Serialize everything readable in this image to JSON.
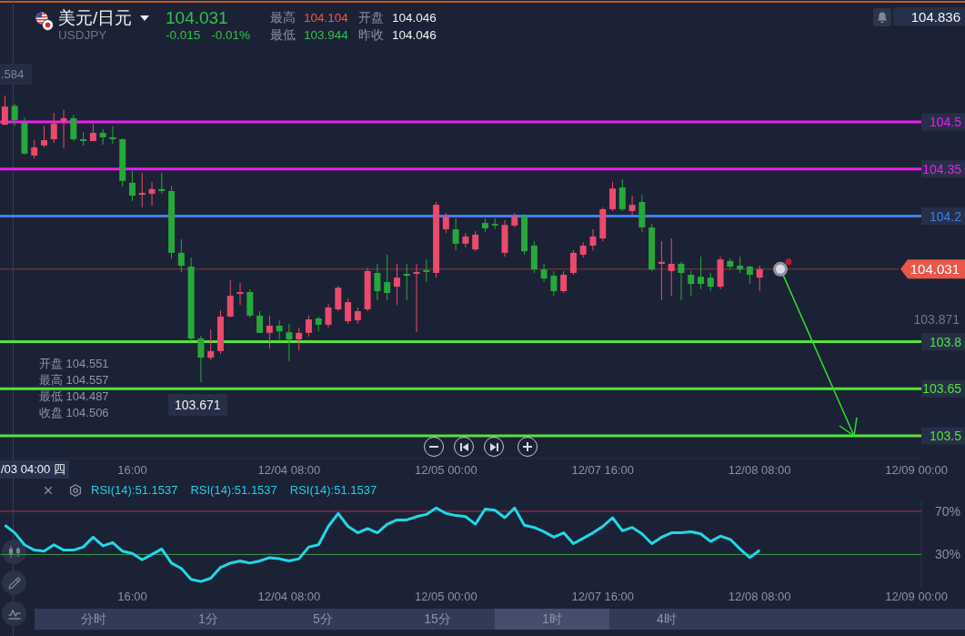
{
  "header": {
    "pair": "美元/日元",
    "symbol": "USDJPY",
    "price": "104.031",
    "change": "-0.015",
    "change_percent": "-0.01%",
    "stats": [
      {
        "label": "最高",
        "value": "104.104",
        "kind": "rise"
      },
      {
        "label": "开盘",
        "value": "104.046",
        "kind": "plain"
      },
      {
        "label": "最低",
        "value": "103.944",
        "kind": "fall"
      },
      {
        "label": "昨收",
        "value": "104.046",
        "kind": "plain"
      }
    ]
  },
  "chart": {
    "crosshair_price": ".584",
    "crosshair_time": "/03 04:00 四",
    "ohlc_readout": [
      "开盘 104.551",
      "最高 104.557",
      "最低 104.487",
      "收盘 104.506"
    ],
    "low_marker": "103.671",
    "chart_data": {
      "type": "candlestick",
      "categories": [
        null,
        null,
        null,
        null,
        null,
        null,
        null,
        null,
        null,
        null,
        null,
        null,
        null,
        "16:00",
        null,
        null,
        null,
        null,
        null,
        null,
        null,
        null,
        null,
        null,
        null,
        null,
        null,
        null,
        null,
        "12/04 08:00",
        null,
        null,
        null,
        null,
        null,
        null,
        null,
        null,
        null,
        null,
        null,
        null,
        null,
        null,
        null,
        "12/05 00:00",
        null,
        null,
        null,
        null,
        null,
        null,
        null,
        null,
        null,
        null,
        null,
        null,
        null,
        null,
        null,
        "12/07 16:00",
        null,
        null,
        null,
        null,
        null,
        null,
        null,
        null,
        null,
        null,
        null,
        null,
        null,
        null,
        null,
        "12/08 08:00",
        null,
        null,
        null,
        null,
        null,
        null,
        null,
        null,
        null,
        null,
        null,
        null,
        null,
        null,
        null,
        "12/09 00:00"
      ],
      "ohlc": [
        [
          104.491,
          104.584,
          104.491,
          104.549
        ],
        [
          104.551,
          104.557,
          104.487,
          104.506
        ],
        [
          104.497,
          104.514,
          104.396,
          104.399
        ],
        [
          104.393,
          104.442,
          104.384,
          104.419
        ],
        [
          104.425,
          104.488,
          104.419,
          104.442
        ],
        [
          104.445,
          104.529,
          104.433,
          104.494
        ],
        [
          104.503,
          104.538,
          104.416,
          104.512
        ],
        [
          104.512,
          104.523,
          104.439,
          104.445
        ],
        [
          104.445,
          104.468,
          104.425,
          104.439
        ],
        [
          104.439,
          104.494,
          104.439,
          104.465
        ],
        [
          104.465,
          104.477,
          104.428,
          104.451
        ],
        [
          104.451,
          104.486,
          104.43,
          104.445
        ],
        [
          104.445,
          104.448,
          104.294,
          104.312
        ],
        [
          104.306,
          104.343,
          104.248,
          104.265
        ],
        [
          104.268,
          104.338,
          104.228,
          104.274
        ],
        [
          104.271,
          104.309,
          104.233,
          104.286
        ],
        [
          104.286,
          104.338,
          104.271,
          104.28
        ],
        [
          104.28,
          104.297,
          104.065,
          104.083
        ],
        [
          104.083,
          104.126,
          104.022,
          104.042
        ],
        [
          104.039,
          104.068,
          103.804,
          103.81
        ],
        [
          103.81,
          103.819,
          103.671,
          103.749
        ],
        [
          103.749,
          103.839,
          103.741,
          103.77
        ],
        [
          103.77,
          103.9,
          103.761,
          103.88
        ],
        [
          103.88,
          103.996,
          103.877,
          103.946
        ],
        [
          103.952,
          103.987,
          103.917,
          103.958
        ],
        [
          103.958,
          103.967,
          103.877,
          103.883
        ],
        [
          103.883,
          103.897,
          103.828,
          103.828
        ],
        [
          103.828,
          103.883,
          103.778,
          103.851
        ],
        [
          103.851,
          103.868,
          103.807,
          103.833
        ],
        [
          103.83,
          103.857,
          103.738,
          103.807
        ],
        [
          103.807,
          103.845,
          103.772,
          103.828
        ],
        [
          103.828,
          103.883,
          103.816,
          103.871
        ],
        [
          103.874,
          103.88,
          103.833,
          103.854
        ],
        [
          103.854,
          103.92,
          103.845,
          103.909
        ],
        [
          103.903,
          103.978,
          103.897,
          103.972
        ],
        [
          103.865,
          103.938,
          103.857,
          103.926
        ],
        [
          103.868,
          103.909,
          103.857,
          103.897
        ],
        [
          103.903,
          104.036,
          103.897,
          104.025
        ],
        [
          104.019,
          104.048,
          103.932,
          103.961
        ],
        [
          103.99,
          104.077,
          103.932,
          103.955
        ],
        [
          103.975,
          104.048,
          103.917,
          104.004
        ],
        [
          104.016,
          104.048,
          103.932,
          104.01
        ],
        [
          104.016,
          104.048,
          103.83,
          104.022
        ],
        [
          104.028,
          104.062,
          103.99,
          104.022
        ],
        [
          104.019,
          104.245,
          104.004,
          104.236
        ],
        [
          104.158,
          104.21,
          104.146,
          104.199
        ],
        [
          104.158,
          104.193,
          104.091,
          104.112
        ],
        [
          104.112,
          104.146,
          104.1,
          104.135
        ],
        [
          104.094,
          104.152,
          104.088,
          104.141
        ],
        [
          104.178,
          104.193,
          104.149,
          104.161
        ],
        [
          104.175,
          104.193,
          104.158,
          104.17
        ],
        [
          104.083,
          104.187,
          104.071,
          104.172
        ],
        [
          104.17,
          104.21,
          104.164,
          104.199
        ],
        [
          104.199,
          104.207,
          104.077,
          104.088
        ],
        [
          104.106,
          104.12,
          104.019,
          104.03
        ],
        [
          104.03,
          104.048,
          103.99,
          104.001
        ],
        [
          104.01,
          104.025,
          103.946,
          103.961
        ],
        [
          103.961,
          104.025,
          103.955,
          104.013
        ],
        [
          104.019,
          104.091,
          104.013,
          104.083
        ],
        [
          104.077,
          104.117,
          104.068,
          104.106
        ],
        [
          104.106,
          104.158,
          104.091,
          104.135
        ],
        [
          104.129,
          104.228,
          104.12,
          104.222
        ],
        [
          104.222,
          104.309,
          104.216,
          104.288
        ],
        [
          104.291,
          104.317,
          104.216,
          104.222
        ],
        [
          104.216,
          104.265,
          104.204,
          104.236
        ],
        [
          104.245,
          104.268,
          104.149,
          104.164
        ],
        [
          104.164,
          104.175,
          104.025,
          104.03
        ],
        [
          104.048,
          104.12,
          103.932,
          104.054
        ],
        [
          104.025,
          104.129,
          103.946,
          104.048
        ],
        [
          104.048,
          104.054,
          103.932,
          104.019
        ],
        [
          104.013,
          104.025,
          103.946,
          103.984
        ],
        [
          104.007,
          104.071,
          103.967,
          103.984
        ],
        [
          104.004,
          104.019,
          103.961,
          103.975
        ],
        [
          103.975,
          104.071,
          103.967,
          104.062
        ],
        [
          104.057,
          104.065,
          104.03,
          104.039
        ],
        [
          104.042,
          104.071,
          104.019,
          104.03
        ],
        [
          104.039,
          104.042,
          103.984,
          104.013
        ],
        [
          104.004,
          104.042,
          103.961,
          104.031
        ],
        null,
        null,
        null,
        null,
        null,
        null,
        null,
        null,
        null,
        null,
        null,
        null,
        null,
        null,
        null,
        null
      ],
      "ylim": [
        103.428,
        104.836
      ],
      "yticks": [
        {
          "value": 104.836,
          "label": "104.836"
        },
        {
          "value": 104.5,
          "label": "104.5"
        },
        {
          "value": 104.35,
          "label": "104.35"
        },
        {
          "value": 104.2,
          "label": "104.2"
        },
        {
          "value": 104.031,
          "label": "104.031"
        },
        {
          "value": 103.871,
          "label": "103.871"
        },
        {
          "value": 103.8,
          "label": "103.8"
        },
        {
          "value": 103.65,
          "label": "103.65"
        },
        {
          "value": 103.5,
          "label": "103.5"
        }
      ],
      "ref_lines": [
        {
          "axis": "y",
          "value": 104.5,
          "color": "#ee1cee"
        },
        {
          "axis": "y",
          "value": 104.35,
          "color": "#ee1cee"
        },
        {
          "axis": "y",
          "value": 104.2,
          "color": "#3f7ff0"
        },
        {
          "axis": "y",
          "value": 104.031,
          "color": "#e9564a"
        },
        {
          "axis": "y",
          "value": 103.8,
          "color": "#55e33b"
        },
        {
          "axis": "y",
          "value": 103.65,
          "color": "#55e33b"
        },
        {
          "axis": "y",
          "value": 103.5,
          "color": "#55e33b"
        }
      ]
    }
  },
  "indicator": {
    "legend": [
      "RSI(14):51.1537",
      "RSI(14):51.1537",
      "RSI(14):51.1537"
    ],
    "chart_data": {
      "type": "line",
      "categories": [
        null,
        null,
        null,
        null,
        null,
        null,
        null,
        null,
        null,
        null,
        null,
        null,
        null,
        "16:00",
        null,
        null,
        null,
        null,
        null,
        null,
        null,
        null,
        null,
        null,
        null,
        null,
        null,
        null,
        null,
        "12/04 08:00",
        null,
        null,
        null,
        null,
        null,
        null,
        null,
        null,
        null,
        null,
        null,
        null,
        null,
        null,
        null,
        "12/05 00:00",
        null,
        null,
        null,
        null,
        null,
        null,
        null,
        null,
        null,
        null,
        null,
        null,
        null,
        null,
        null,
        "12/07 16:00",
        null,
        null,
        null,
        null,
        null,
        null,
        null,
        null,
        null,
        null,
        null,
        null,
        null,
        null,
        null,
        "12/08 08:00",
        null,
        null,
        null,
        null,
        null,
        null,
        null,
        null,
        null,
        null,
        null,
        null,
        null,
        null,
        null,
        "12/09 00:00"
      ],
      "values": [
        57,
        50,
        39,
        34,
        33,
        39,
        34,
        34,
        37,
        46,
        38,
        41,
        33,
        31,
        25,
        30,
        35,
        22,
        17,
        7,
        5,
        8,
        18,
        22,
        24,
        22,
        24,
        27,
        26,
        24,
        26,
        37,
        39,
        56,
        68,
        56,
        50,
        54,
        50,
        58,
        62,
        62,
        65,
        67,
        73,
        68,
        66,
        65,
        58,
        72,
        71,
        64,
        73,
        57,
        55,
        51,
        46,
        50,
        40,
        45,
        50,
        56,
        64,
        52,
        55,
        49,
        40,
        46,
        50,
        50,
        51,
        49,
        42,
        47,
        44,
        35,
        27,
        34,
        null,
        null,
        null,
        null,
        null,
        null,
        null,
        null,
        null,
        null,
        null,
        null,
        null,
        null,
        null,
        null
      ],
      "ylim": [
        0,
        80
      ],
      "yticks": [
        {
          "value": 30,
          "label": "30%"
        },
        {
          "value": 70,
          "label": "70%"
        }
      ],
      "ref_lines": [
        {
          "axis": "y",
          "value": 70,
          "color": "#a03a4e"
        },
        {
          "axis": "y",
          "value": 30,
          "color": "#3d9a4b"
        }
      ]
    }
  },
  "period_tabs": [
    {
      "label": "分时",
      "selected": false
    },
    {
      "label": "1分",
      "selected": false
    },
    {
      "label": "5分",
      "selected": false
    },
    {
      "label": "15分",
      "selected": false
    },
    {
      "label": "1时",
      "selected": true
    },
    {
      "label": "4时",
      "selected": false
    }
  ]
}
